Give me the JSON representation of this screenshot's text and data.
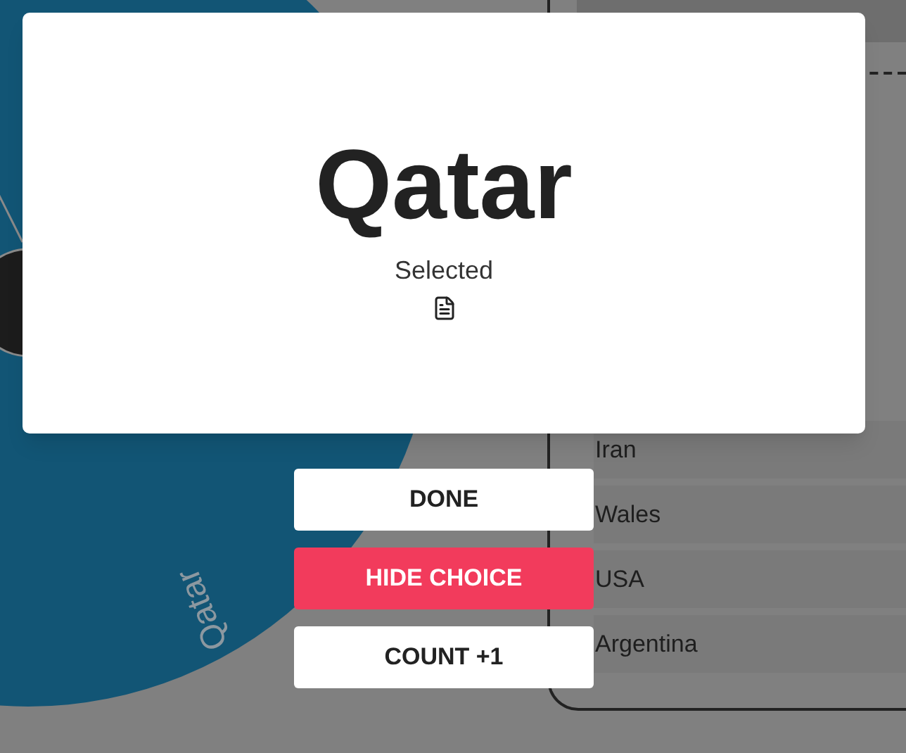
{
  "wheel": {
    "segment_label": "Qatar"
  },
  "list": {
    "items": [
      "Iran",
      "Wales",
      "USA",
      "Argentina"
    ]
  },
  "dialog": {
    "title": "Qatar",
    "status": "Selected"
  },
  "buttons": [
    {
      "label": "DONE",
      "kind": "plain"
    },
    {
      "label": "HIDE CHOICE",
      "kind": "danger"
    },
    {
      "label": "COUNT +1",
      "kind": "plain"
    }
  ]
}
